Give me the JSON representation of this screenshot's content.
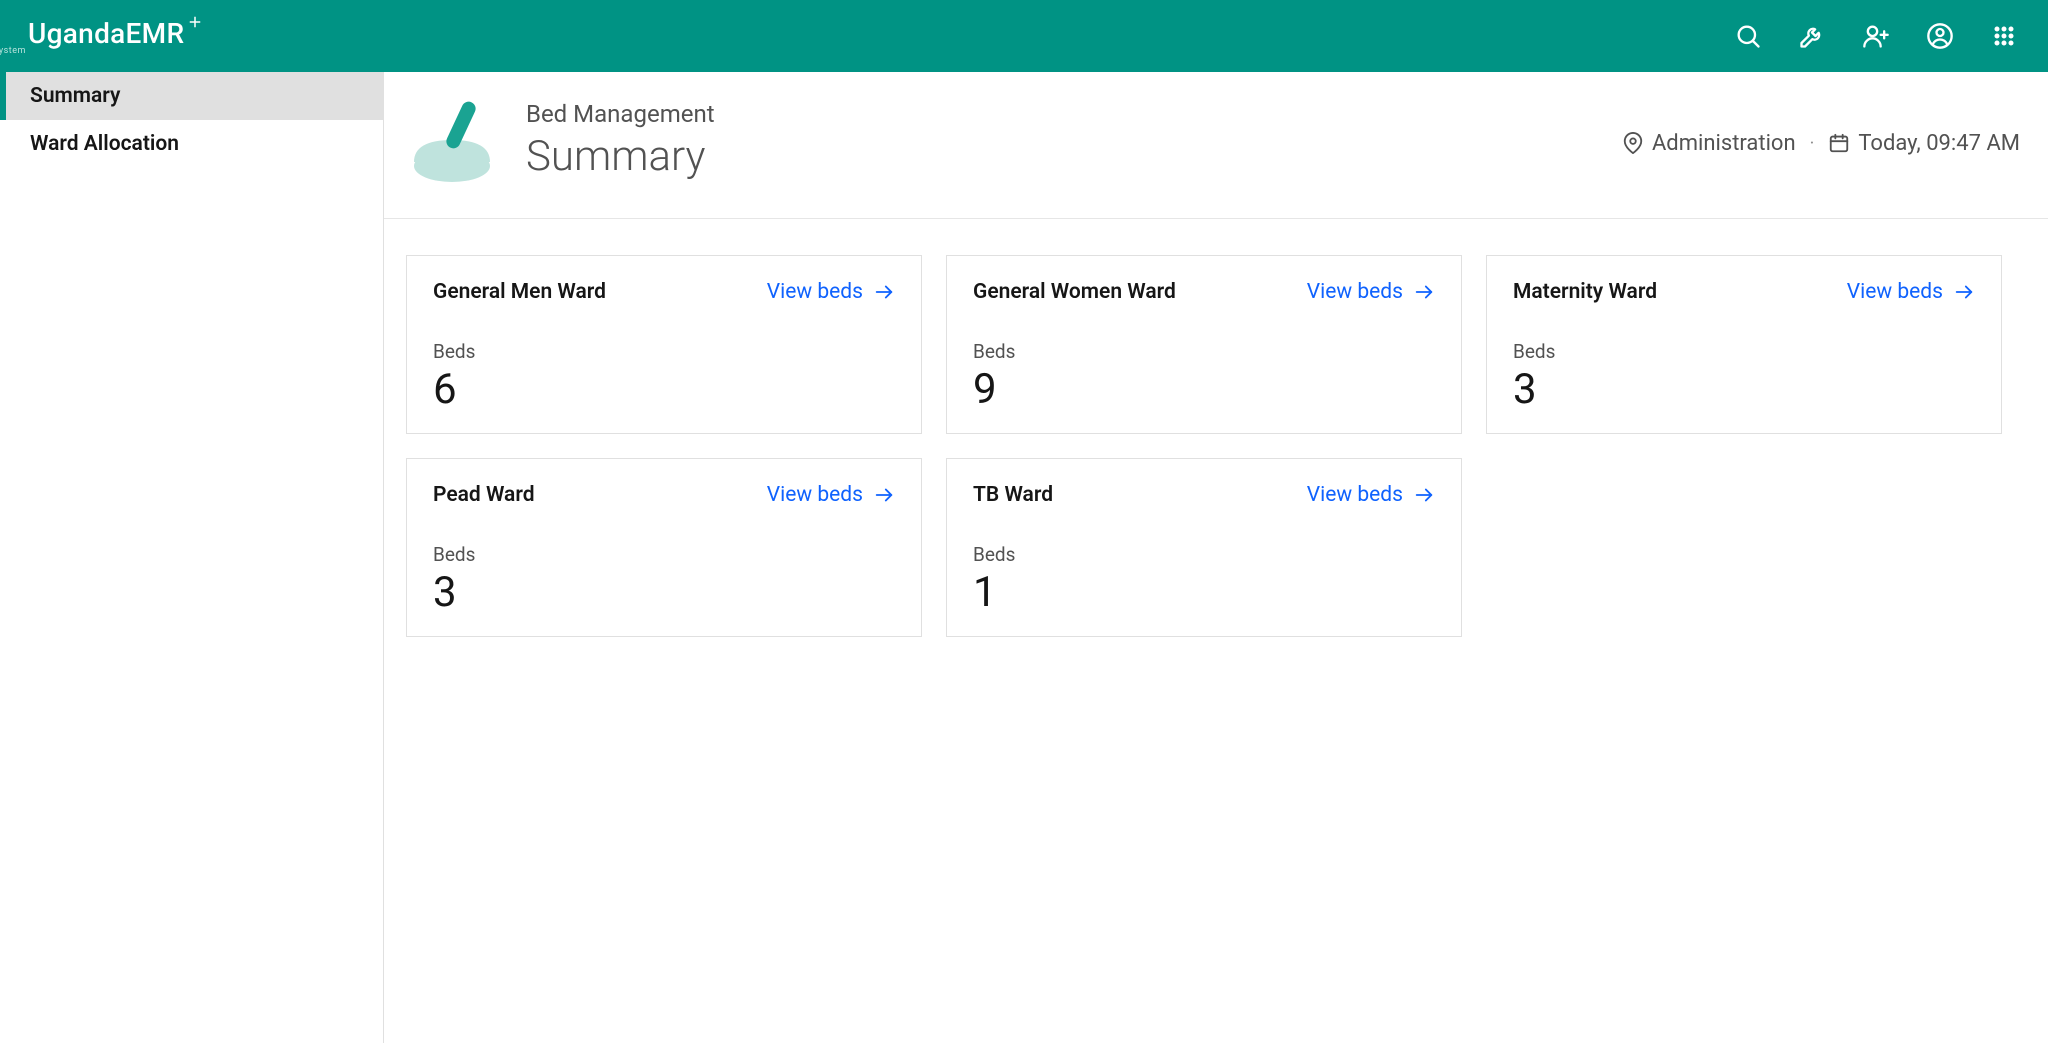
{
  "brand": {
    "name": "UgandaEMR",
    "tagline": "Medical Records System"
  },
  "sidebar": {
    "items": [
      {
        "label": "Summary",
        "active": true
      },
      {
        "label": "Ward Allocation",
        "active": false
      }
    ]
  },
  "page": {
    "breadcrumb": "Bed Management",
    "title": "Summary",
    "location": "Administration",
    "datetime": "Today, 09:47 AM"
  },
  "cards": {
    "beds_label": "Beds",
    "view_label": "View beds",
    "items": [
      {
        "name": "General Men Ward",
        "beds": "6"
      },
      {
        "name": "General Women Ward",
        "beds": "9"
      },
      {
        "name": "Maternity Ward",
        "beds": "3"
      },
      {
        "name": "Pead Ward",
        "beds": "3"
      },
      {
        "name": "TB Ward",
        "beds": "1"
      }
    ]
  }
}
